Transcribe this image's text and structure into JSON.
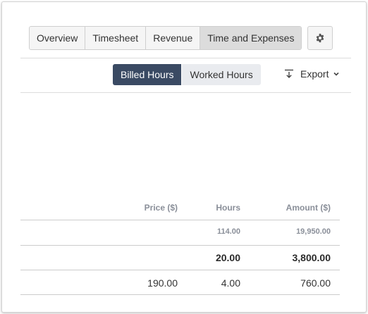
{
  "tabs": [
    {
      "label": "Overview",
      "active": false
    },
    {
      "label": "Timesheet",
      "active": false
    },
    {
      "label": "Revenue",
      "active": false
    },
    {
      "label": "Time and Expenses",
      "active": true
    }
  ],
  "settings_icon": "gear-icon",
  "toggle": {
    "billed_label": "Billed Hours",
    "worked_label": "Worked Hours",
    "selected": "Billed Hours"
  },
  "export": {
    "label": "Export",
    "icon": "download-icon",
    "chevron": "chevron-down-icon"
  },
  "table": {
    "headers": {
      "price": "Price ($)",
      "hours": "Hours",
      "amount": "Amount ($)"
    },
    "subtotal": {
      "hours": "114.00",
      "amount": "19,950.00"
    },
    "total": {
      "hours": "20.00",
      "amount": "3,800.00"
    },
    "rows": [
      {
        "price": "190.00",
        "hours": "4.00",
        "amount": "760.00"
      }
    ]
  },
  "colors": {
    "accent": "#3a4a63",
    "header_text": "#8a8f99"
  }
}
